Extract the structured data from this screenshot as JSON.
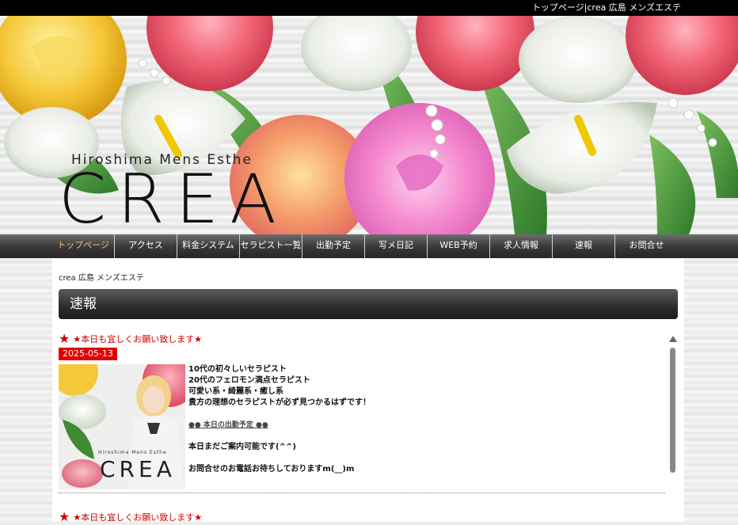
{
  "topbar": {
    "text": "トップページ|crea 広島 メンズエステ"
  },
  "hero": {
    "subtitle": "Hiroshima Mens Esthe",
    "logo": "CREA"
  },
  "nav": {
    "items": [
      "トップページ",
      "アクセス",
      "料金システム",
      "セラピスト一覧",
      "出勤予定",
      "写メ日記",
      "WEB予約",
      "求人情報",
      "速報",
      "お問合せ"
    ],
    "active_index": 0
  },
  "breadcrumb": "crea 広島 メンズエステ",
  "section": {
    "title": "速報"
  },
  "posts": [
    {
      "title": "★本日も宜しくお願い致します★",
      "date": "2025-05-13",
      "thumb_logo": "CREA",
      "thumb_sub": "Hiroshima Mens Esthe",
      "lines": [
        "10代の初々しいセラピスト",
        "20代のフェロモン満点セラピスト",
        "可愛い系・綺麗系・癒し系",
        "貴方の理想のセラピストが必ず見つかるはずです！"
      ],
      "link": "●● 本日の出勤予定 ●●",
      "line_available": "本日まだご案内可能です(^^)",
      "line_contact": "お問合せのお電話お待ちしておりますm(__)m"
    },
    {
      "title": "★本日も宜しくお願い致します★"
    }
  ],
  "colors": {
    "accent_red": "#e00000",
    "nav_active": "#f0c070",
    "header_bg": "#2c2c2c"
  },
  "icons": {
    "post_star": "star-icon",
    "scroll_up": "triangle-up-icon"
  }
}
